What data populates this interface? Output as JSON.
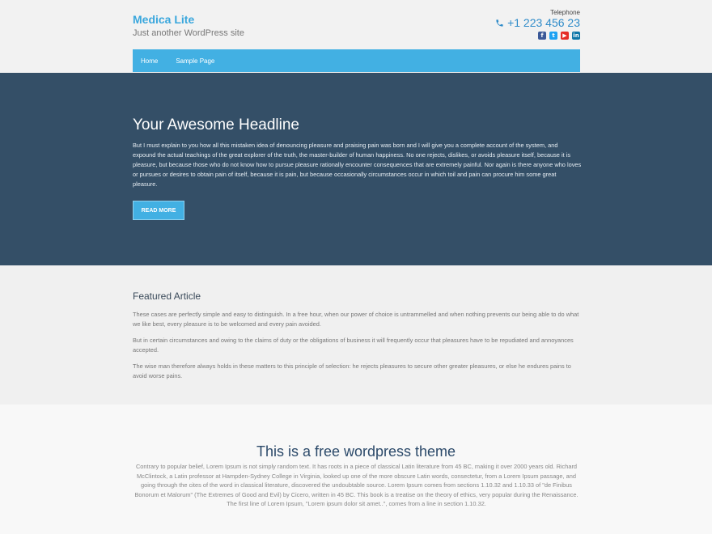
{
  "header": {
    "site_title": "Medica Lite",
    "tagline": "Just another WordPress site",
    "telephone_label": "Telephone",
    "telephone_number": "+1 223 456 23",
    "socials": [
      {
        "name": "facebook-icon",
        "glyph": "f"
      },
      {
        "name": "twitter-icon",
        "glyph": "t"
      },
      {
        "name": "youtube-icon",
        "glyph": "▶"
      },
      {
        "name": "linkedin-icon",
        "glyph": "in"
      }
    ]
  },
  "nav": {
    "items": [
      "Home",
      "Sample Page"
    ]
  },
  "hero": {
    "title": "Your Awesome Headline",
    "text": "But I must explain to you how all this mistaken idea of denouncing pleasure and praising pain was born and I will give you a complete account of the system, and expound the actual teachings of the great explorer of the truth, the master-builder of human happiness. No one rejects, dislikes, or avoids pleasure itself, because it is pleasure, but because those who do not know how to pursue pleasure rationally encounter consequences that are extremely painful. Nor again is there anyone who loves or pursues or desires to obtain pain of itself, because it is pain, but because occasionally circumstances occur in which toil and pain can procure him some great pleasure.",
    "button_label": "READ MORE"
  },
  "featured": {
    "title": "Featured Article",
    "paragraphs": [
      "These cases are perfectly simple and easy to distinguish. In a free hour, when our power of choice is untrammelled and when nothing prevents our being able to do what we like best, every pleasure is to be welcomed and every pain avoided.",
      "But in certain circumstances and owing to the claims of duty or the obligations of business it will frequently occur that pleasures have to be repudiated and annoyances accepted.",
      "The wise man therefore always holds in these matters to this principle of selection: he rejects pleasures to secure other greater pleasures, or else he endures pains to avoid worse pains."
    ]
  },
  "free": {
    "title": "This is a free wordpress theme",
    "text": "Contrary to popular belief, Lorem Ipsum is not simply random text. It has roots in a piece of classical Latin literature from 45 BC, making it over 2000 years old. Richard McClintock, a Latin professor at Hampden-Sydney College in Virginia, looked up one of the more obscure Latin words, consectetur, from a Lorem Ipsum passage, and going through the cites of the word in classical literature, discovered the undoubtable source. Lorem Ipsum comes from sections 1.10.32 and 1.10.33 of \"de Finibus Bonorum et Malorum\" (The Extremes of Good and Evil) by Cicero, written in 45 BC. This book is a treatise on the theory of ethics, very popular during the Renaissance. The first line of Lorem Ipsum, \"Lorem ipsum dolor sit amet..\", comes from a line in section 1.10.32."
  },
  "colors": {
    "accent": "#42b0e3",
    "hero_bg": "#344f67",
    "title_blue": "#3aa7dd"
  }
}
